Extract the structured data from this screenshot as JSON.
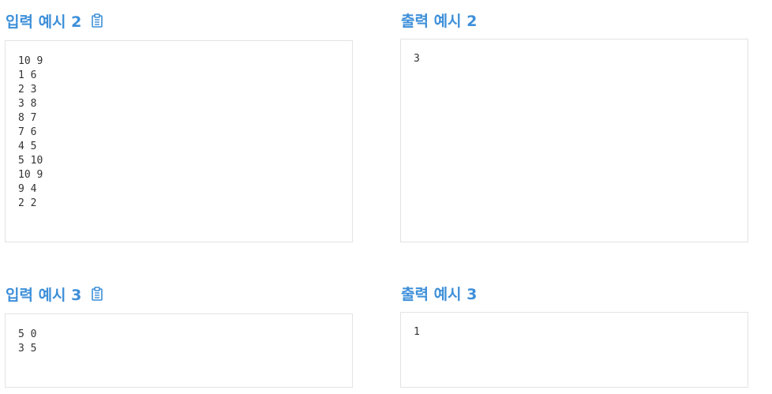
{
  "examples": [
    {
      "input_heading": "입력 예시 2",
      "input_text": "10 9\n1 6\n2 3\n3 8\n8 7\n7 6\n4 5\n5 10\n10 9\n9 4\n2 2",
      "output_heading": "출력 예시 2",
      "output_text": "3"
    },
    {
      "input_heading": "입력 예시 3",
      "input_text": "5 0\n3 5",
      "output_heading": "출력 예시 3",
      "output_text": "1"
    }
  ],
  "icons": {
    "copy": "clipboard-icon"
  },
  "colors": {
    "heading": "#3d8fd9",
    "box_border": "#e3e3e3",
    "text": "#333333"
  }
}
